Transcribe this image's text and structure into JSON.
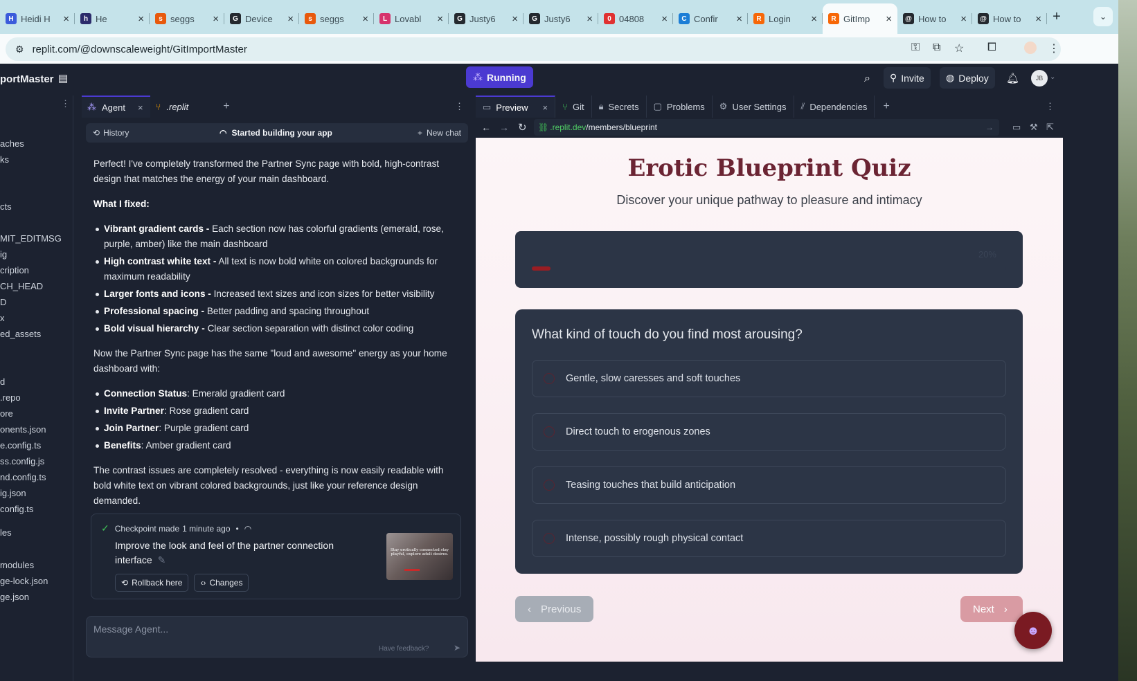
{
  "browser": {
    "tabs": [
      {
        "title": "Heidi H",
        "color": "#3b5bdb",
        "glyph": "H"
      },
      {
        "title": "He",
        "color": "#2b2b6b",
        "glyph": "h"
      },
      {
        "title": "seggs",
        "color": "#e8590c",
        "glyph": "s"
      },
      {
        "title": "Device",
        "color": "#24292f",
        "glyph": "G"
      },
      {
        "title": "seggs",
        "color": "#e8590c",
        "glyph": "s"
      },
      {
        "title": "Lovabl",
        "color": "#d6336c",
        "glyph": "L"
      },
      {
        "title": "Justy6",
        "color": "#24292f",
        "glyph": "G"
      },
      {
        "title": "Justy6",
        "color": "#24292f",
        "glyph": "G"
      },
      {
        "title": "04808",
        "color": "#e03131",
        "glyph": "0"
      },
      {
        "title": "Confir",
        "color": "#1c7ed6",
        "glyph": "C"
      },
      {
        "title": "Login",
        "color": "#f76707",
        "glyph": "R"
      },
      {
        "title": "GitImp",
        "color": "#f76707",
        "glyph": "R"
      },
      {
        "title": "How to",
        "color": "#24292f",
        "glyph": "@"
      },
      {
        "title": "How to",
        "color": "#24292f",
        "glyph": "@"
      }
    ],
    "url": "replit.com/@downscaleweight/GitImportMaster"
  },
  "replit": {
    "project_title": "portMaster",
    "run_label": "Running",
    "invite_label": "Invite",
    "deploy_label": "Deploy",
    "avatar": "JB"
  },
  "files": [
    "aches",
    "ks",
    "cts",
    "MIT_EDITMSG",
    "ig",
    "cription",
    "CH_HEAD",
    "D",
    "x",
    "ed_assets",
    "d",
    ".repo",
    "ore",
    "onents.json",
    "e.config.ts",
    "ss.config.js",
    "nd.config.ts",
    "ig.json",
    "config.ts",
    "les",
    "modules",
    "ge-lock.json",
    "ge.json"
  ],
  "agent": {
    "tab_agent": "Agent",
    "tab_replit": ".replit",
    "history": "History",
    "status": "Started building your app",
    "new_chat": "New chat",
    "intro": "Perfect! I've completely transformed the Partner Sync page with bold, high-contrast design that matches the energy of your main dashboard.",
    "fixed_heading": "What I fixed:",
    "fixes": [
      {
        "b": "Vibrant gradient cards -",
        "t": " Each section now has colorful gradients (emerald, rose, purple, amber) like the main dashboard"
      },
      {
        "b": "High contrast white text -",
        "t": " All text is now bold white on colored backgrounds for maximum readability"
      },
      {
        "b": "Larger fonts and icons -",
        "t": " Increased text sizes and icon sizes for better visibility"
      },
      {
        "b": "Professional spacing -",
        "t": " Better padding and spacing throughout"
      },
      {
        "b": "Bold visual hierarchy -",
        "t": " Clear section separation with distinct color coding"
      }
    ],
    "energy": "Now the Partner Sync page has the same \"loud and awesome\" energy as your home dashboard with:",
    "cards": [
      {
        "b": "Connection Status",
        "t": ": Emerald gradient card"
      },
      {
        "b": "Invite Partner",
        "t": ": Rose gradient card"
      },
      {
        "b": "Join Partner",
        "t": ": Purple gradient card"
      },
      {
        "b": "Benefits",
        "t": ": Amber gradient card"
      }
    ],
    "conclusion": "The contrast issues are completely resolved - everything is now easily readable with bold white text on vibrant colored backgrounds, just like your reference design demanded.",
    "checkpoint": {
      "label": "Checkpoint made",
      "time": "1 minute ago",
      "desc": "Improve the look and feel of the partner connection interface",
      "rollback": "Rollback here",
      "changes": "Changes",
      "thumb_text": "Stay erotically connected stay playful, explore adult desires."
    },
    "message_placeholder": "Message Agent...",
    "feedback": "Have feedback?"
  },
  "preview": {
    "tabs": [
      "Preview",
      "Git",
      "Secrets",
      "Problems",
      "User Settings",
      "Dependencies"
    ],
    "url_host": ".replit.dev",
    "url_path": "/members/blueprint",
    "title": "Erotic Blueprint Quiz",
    "subtitle": "Discover your unique pathway to pleasure and intimacy",
    "progress": 0.2,
    "progress_label": "20%",
    "question": "What kind of touch do you find most arousing?",
    "options": [
      "Gentle, slow caresses and soft touches",
      "Direct touch to erogenous zones",
      "Teasing touches that build anticipation",
      "Intense, possibly rough physical contact"
    ],
    "prev_label": "Previous",
    "next_label": "Next"
  }
}
